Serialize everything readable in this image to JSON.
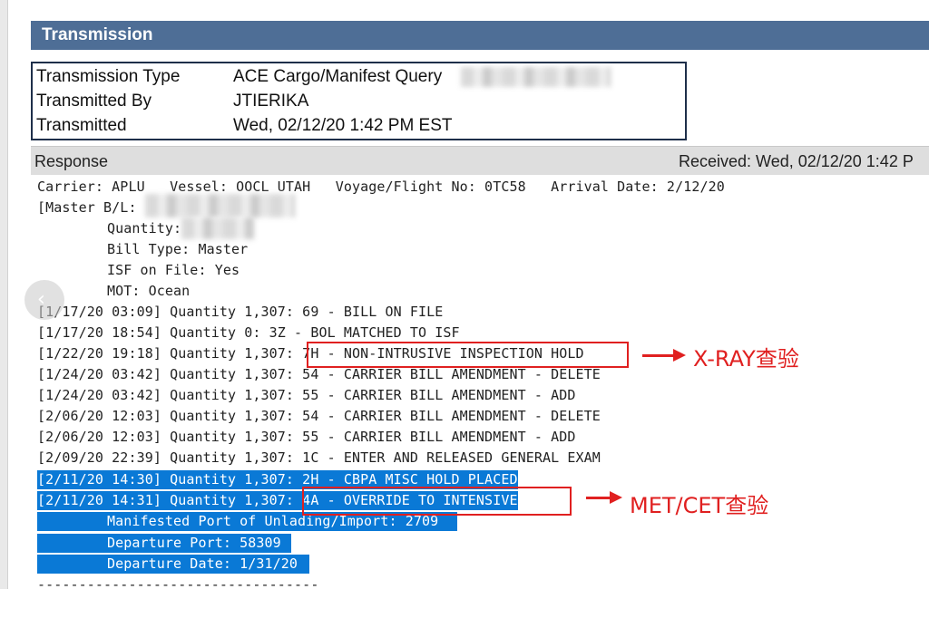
{
  "header": {
    "title": "Transmission"
  },
  "info": {
    "type_label": "Transmission Type",
    "type_value": "ACE Cargo/Manifest Query",
    "by_label": "Transmitted By",
    "by_value": "JTIERIKA",
    "time_label": "Transmitted",
    "time_value": "Wed, 02/12/20 1:42 PM EST"
  },
  "response": {
    "label": "Response",
    "received": "Received: Wed, 02/12/20 1:42 P"
  },
  "details": {
    "carrier_line": "Carrier: APLU   Vessel: OOCL UTAH   Voyage/Flight No: 0TC58   Arrival Date: 2/12/20",
    "master_bl": "[Master B/L:",
    "quantity": "Quantity:",
    "bill_type": "Bill Type: Master",
    "isf": "ISF on File: Yes",
    "mot": "MOT: Ocean"
  },
  "events": [
    "[1/17/20 03:09] Quantity 1,307: 69 - BILL ON FILE",
    "[1/17/20 18:54] Quantity 0: 3Z - BOL MATCHED TO ISF",
    "[1/22/20 19:18] Quantity 1,307: 7H - NON-INTRUSIVE INSPECTION HOLD",
    "[1/24/20 03:42] Quantity 1,307: 54 - CARRIER BILL AMENDMENT - DELETE",
    "[1/24/20 03:42] Quantity 1,307: 55 - CARRIER BILL AMENDMENT - ADD",
    "[2/06/20 12:03] Quantity 1,307: 54 - CARRIER BILL AMENDMENT - DELETE",
    "[2/06/20 12:03] Quantity 1,307: 55 - CARRIER BILL AMENDMENT - ADD",
    "[2/09/20 22:39] Quantity 1,307: 1C - ENTER AND RELEASED GENERAL EXAM",
    "[2/11/20 14:30] Quantity 1,307: 2H - CBPA MISC HOLD PLACED",
    "[2/11/20 14:31] Quantity 1,307: 4A - OVERRIDE TO INTENSIVE"
  ],
  "trailer": {
    "port_unlading": "Manifested Port of Unlading/Import: 2709",
    "departure_port": "Departure Port: 58309",
    "departure_date": "Departure Date: 1/31/20",
    "separator": "----------------------------------"
  },
  "annotations": {
    "xray": "X-RAY查验",
    "met": "MET/CET查验"
  },
  "nav": {
    "prev_icon": "‹"
  },
  "colors": {
    "header": "#4e6e96",
    "selection": "#0a79d6",
    "annotation": "#e02020"
  }
}
